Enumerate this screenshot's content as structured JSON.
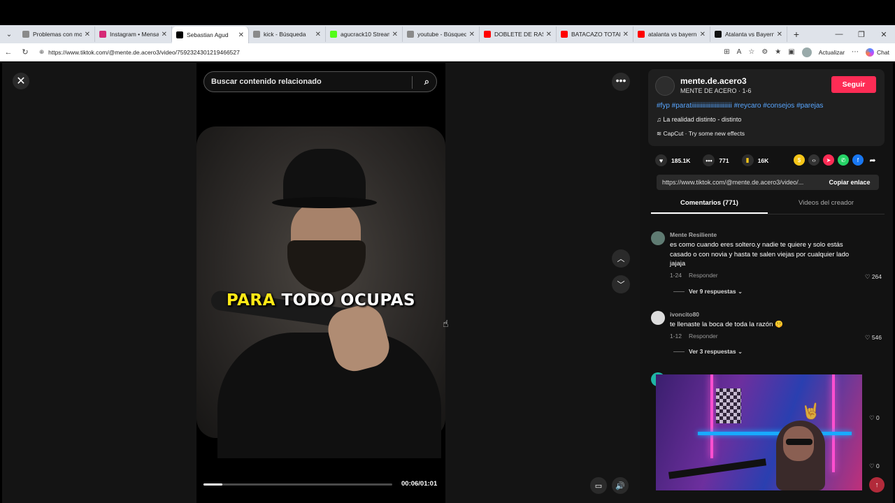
{
  "browser": {
    "tabs": [
      {
        "title": "Problemas con mou",
        "favicon_color": "#8a8a8a"
      },
      {
        "title": "Instagram • Mensaje",
        "favicon_color": "#d62976"
      },
      {
        "title": "Sebastian Agud",
        "favicon_color": "#000000"
      },
      {
        "title": "kick - Búsqueda",
        "favicon_color": "#8a8a8a"
      },
      {
        "title": "agucrack10 Stream",
        "favicon_color": "#53fc18"
      },
      {
        "title": "youtube - Búsqueda",
        "favicon_color": "#8a8a8a"
      },
      {
        "title": "DOBLETE DE RASHF",
        "favicon_color": "#ff0000"
      },
      {
        "title": "BATACAZO TOTAL: G",
        "favicon_color": "#ff0000"
      },
      {
        "title": "atalanta vs bayern m",
        "favicon_color": "#ff0000"
      },
      {
        "title": "Atalanta vs Bayern M",
        "favicon_color": "#111111"
      }
    ],
    "url": "https://www.tiktok.com/@mente.de.acero3/video/7592324301219466527",
    "update_label": "Actualizar",
    "chat_label": "Chat"
  },
  "video": {
    "search_placeholder": "Buscar contenido relacionado",
    "caption_highlight": "PARA",
    "caption_rest": "TODO OCUPAS",
    "time": "00:06/01:01",
    "progress_fraction": 0.1
  },
  "creator": {
    "username": "mente.de.acero3",
    "subtitle": "MENTE DE ACERO · 1-6",
    "follow_label": "Seguir",
    "hashtags": "#fyp #paratiiiiiiiiiiiiiiiiiiiiiiiiii #reycaro #consejos #parejas",
    "music": "La realidad distinto - distinto",
    "effect": "CapCut · Try some new effects"
  },
  "stats": {
    "likes": "185.1K",
    "comments": "771",
    "saves": "16K"
  },
  "link": {
    "url": "https://www.tiktok.com/@mente.de.acero3/video/...",
    "copy_label": "Copiar enlace"
  },
  "panel_tabs": {
    "comments": "Comentarios (771)",
    "creator_videos": "Videos del creador"
  },
  "comments": [
    {
      "user": "Mente Resiliente",
      "text": "es como cuando eres soltero.y nadie te quiere y solo estás casado o con novia y hasta te salen viejas por cualquier lado jajaja",
      "date": "1-24",
      "reply": "Responder",
      "likes": "264",
      "replies": "Ver 9 respuestas"
    },
    {
      "user": "ivoncito80",
      "text": "te llenaste la boca de toda la razón 🤫",
      "date": "1-12",
      "reply": "Responder",
      "likes": "546",
      "replies": "Ver 3 respuestas"
    }
  ],
  "extra_likes": [
    "0",
    "0"
  ]
}
